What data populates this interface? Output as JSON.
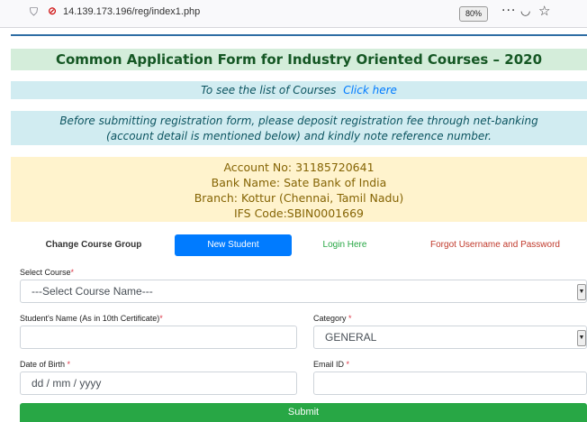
{
  "browser": {
    "url": "14.139.173.196/reg/index1.php",
    "zoom": "80%",
    "icons": [
      "shield-icon",
      "insecure-lock-icon",
      "more-dots-icon",
      "pocket-icon",
      "bookmark-star-icon"
    ]
  },
  "header": {
    "title": "Common Application Form for Industry Oriented Courses – 2020",
    "courses_text": "To see the list of Courses",
    "courses_link": "Click here",
    "note_line1": "Before submitting registration form, please deposit registration fee through net-banking",
    "note_line2": "(account detail is mentioned below) and kindly note reference number."
  },
  "account": {
    "account_no": "Account No: 31185720641",
    "bank_name": "Bank Name: Sate Bank of India",
    "branch": "Branch: Kottur (Chennai, Tamil Nadu)",
    "ifsc": "IFS Code:SBIN0001669"
  },
  "nav": {
    "change_course": "Change Course Group",
    "new_student": "New Student",
    "login": "Login Here",
    "forgot": "Forgot Username and Password"
  },
  "form": {
    "course_label": "Select Course",
    "course_value": "---Select Course Name---",
    "name_label": "Student's Name (As in 10th Certificate)",
    "category_label": "Category ",
    "category_value": "GENERAL",
    "dob_label": "Date of Birth ",
    "dob_placeholder": "dd / mm / yyyy",
    "email_label": "Email ID ",
    "required_mark": "*",
    "submit": "Submit"
  },
  "colors": {
    "title_bg": "#d4edda",
    "info_bg": "#d1ecf1",
    "account_bg": "#fff3cd",
    "primary": "#007bff",
    "submit": "#28a745"
  }
}
